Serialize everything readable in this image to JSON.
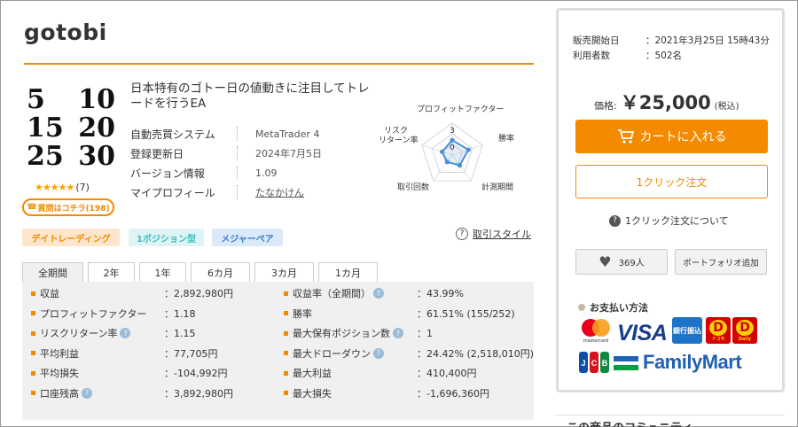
{
  "product": {
    "title": "gotobi",
    "logo_rows": [
      [
        "5",
        "10"
      ],
      [
        "15",
        "20"
      ],
      [
        "25",
        "30"
      ]
    ],
    "stars": "★★★★★",
    "review_count": "(7)",
    "question_button": "質問はコチラ(198)",
    "description": "日本特有のゴトー日の値動きに注目してトレードを行うEA"
  },
  "info": [
    {
      "label": "自動売買システム",
      "value": "MetaTrader 4"
    },
    {
      "label": "登録更新日",
      "value": "2024年7月5日"
    },
    {
      "label": "バージョン情報",
      "value": "1.09"
    },
    {
      "label": "マイプロフィール",
      "value": "たなかけん"
    }
  ],
  "radar": {
    "axes": [
      "プロフィットファクター",
      "勝率",
      "計測期間",
      "取引回数",
      "リスクリターン率"
    ],
    "scale_label": "3",
    "center_label": "0",
    "values": [
      1.4,
      1.6,
      1.2,
      0.8,
      1.0
    ],
    "max": 3,
    "color": "#4a90d9"
  },
  "tags": [
    "デイトレーディング",
    "1ポジション型",
    "メジャーペア"
  ],
  "trade_style_link": "取引スタイル",
  "tabs": [
    "全期間",
    "2年",
    "1年",
    "6カ月",
    "3カ月",
    "1カ月"
  ],
  "stats_left": [
    {
      "label": "収益",
      "value": "：2,892,980円",
      "help": false
    },
    {
      "label": "プロフィットファクター",
      "value": "：1.18",
      "help": false
    },
    {
      "label": "リスクリターン率",
      "value": "：1.15",
      "help": true
    },
    {
      "label": "平均利益",
      "value": "：77,705円",
      "help": false
    },
    {
      "label": "平均損失",
      "value": "：-104,992円",
      "help": false
    },
    {
      "label": "口座残高",
      "value": "：3,892,980円",
      "help": true
    }
  ],
  "stats_right": [
    {
      "label": "収益率（全期間）",
      "value": "：43.99%",
      "help": true
    },
    {
      "label": "勝率",
      "value": "：61.51% (155/252)",
      "help": false
    },
    {
      "label": "最大保有ポジション数",
      "value": "：1",
      "help": true
    },
    {
      "label": "最大ドローダウン",
      "value": "：24.42% (2,518,010円)",
      "help": true
    },
    {
      "label": "最大利益",
      "value": "：410,400円",
      "help": false
    },
    {
      "label": "最大損失",
      "value": "：-1,696,360円",
      "help": false
    }
  ],
  "panel": {
    "sale_start_label": "販売開始日",
    "sale_start_value": "：2021年3月25日 15時43分",
    "users_label": "利用者数",
    "users_value": "：502名",
    "price_label": "価格:",
    "price_value": "￥25,000",
    "price_tax": "(税込)",
    "cart_button": "カートに入れる",
    "oneclick_button": "1クリック注文",
    "oneclick_about": "1クリック注文について",
    "fav_count": "369人",
    "portfolio_button": "ポートフォリオ追加",
    "payment_title": "お支払い方法",
    "mastercard_label": "mastercard",
    "visa_label": "VISA",
    "bank_label": "銀行振込",
    "docomo_label": "D",
    "docomo_sub1": "ドコモ",
    "docomo_sub2": "Daily",
    "familymart_label": "FamilyMart"
  },
  "community_title": "この商品のコミュニティ",
  "colors": {
    "accent": "#f08a00",
    "tag_blue": "#3a7fd0",
    "tag_teal": "#3bbcc0"
  }
}
